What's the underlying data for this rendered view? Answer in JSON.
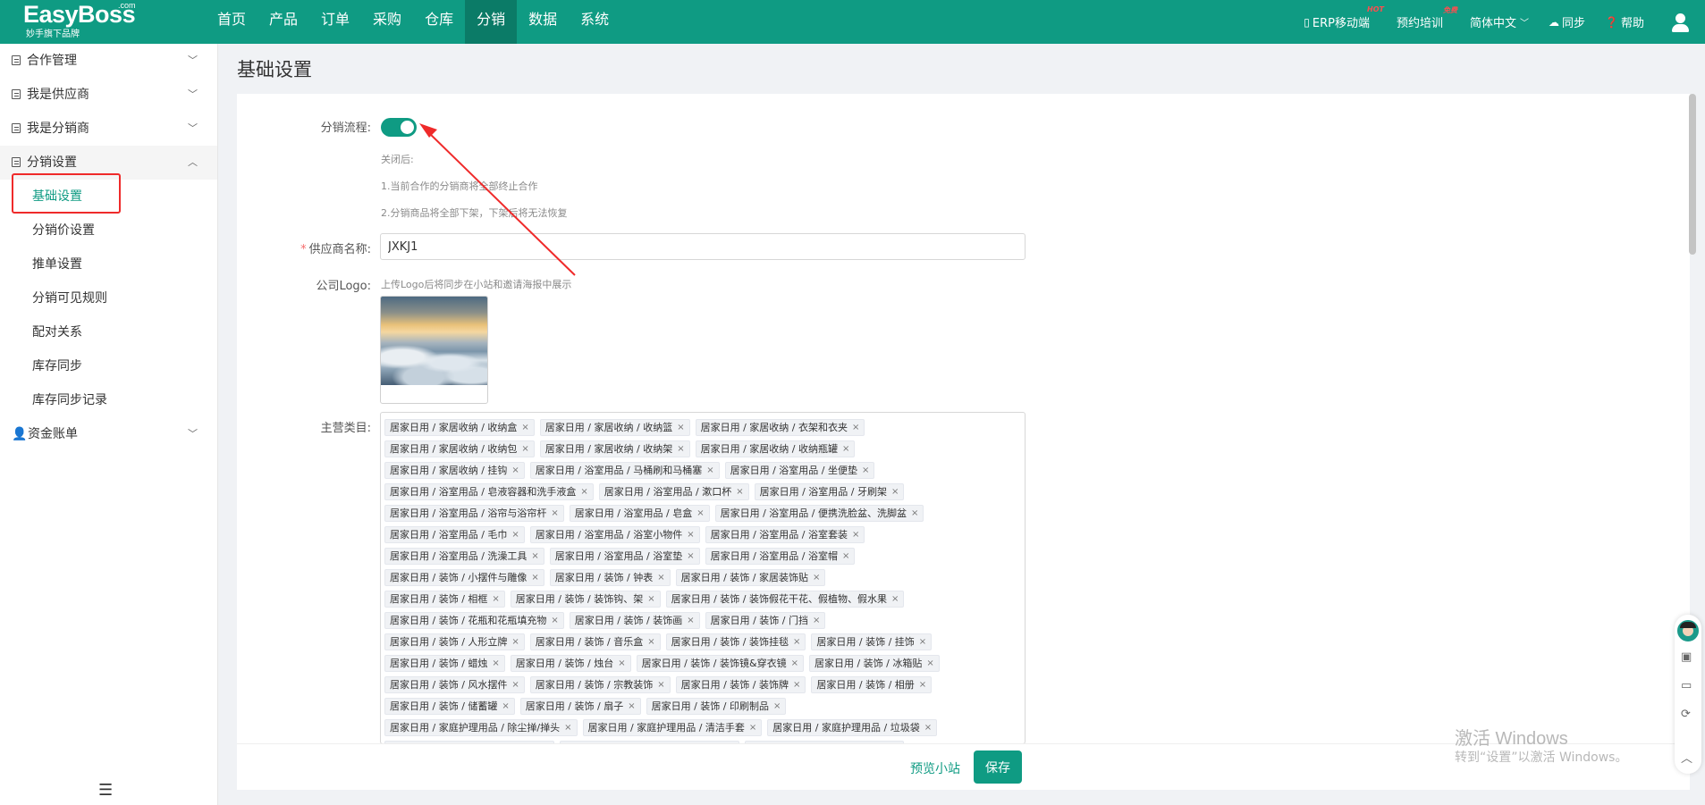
{
  "brand": {
    "name": "EasyBoss",
    "com": ".com",
    "slogan": "妙手旗下品牌"
  },
  "nav": [
    {
      "label": "首页"
    },
    {
      "label": "产品"
    },
    {
      "label": "订单"
    },
    {
      "label": "采购"
    },
    {
      "label": "仓库"
    },
    {
      "label": "分销"
    },
    {
      "label": "数据"
    },
    {
      "label": "系统"
    }
  ],
  "top_right": {
    "erp": "ERP移动端",
    "erp_badge": "HOT",
    "training": "预约培训",
    "training_badge": "免费",
    "language": "简体中文",
    "sync": "同步",
    "help": "帮助"
  },
  "sidebar": {
    "groups": [
      {
        "label": "合作管理"
      },
      {
        "label": "我是供应商"
      },
      {
        "label": "我是分销商"
      },
      {
        "label": "分销设置"
      },
      {
        "label": "资金账单"
      }
    ],
    "sub_items": [
      {
        "label": "基础设置"
      },
      {
        "label": "分销价设置"
      },
      {
        "label": "推单设置"
      },
      {
        "label": "分销可见规则"
      },
      {
        "label": "配对关系"
      },
      {
        "label": "库存同步"
      },
      {
        "label": "库存同步记录"
      }
    ]
  },
  "page": {
    "title": "基础设置"
  },
  "form": {
    "flow_label": "分销流程:",
    "flow_enabled": true,
    "hints": [
      "关闭后:",
      "1.当前合作的分销商将全部终止合作",
      "2.分销商品将全部下架，下架后将无法恢复"
    ],
    "supplier_label": "供应商名称:",
    "supplier_value": "JXKJ1",
    "logo_label": "公司Logo:",
    "logo_hint": "上传Logo后将同步在小站和邀请海报中展示",
    "category_label": "主营类目:",
    "tag_rows": [
      [
        "居家日用 / 家居收纳 / 收纳盒",
        "居家日用 / 家居收纳 / 收纳篮",
        "居家日用 / 家居收纳 / 衣架和衣夹"
      ],
      [
        "居家日用 / 家居收纳 / 收纳包",
        "居家日用 / 家居收纳 / 收纳架",
        "居家日用 / 家居收纳 / 收纳瓶罐"
      ],
      [
        "居家日用 / 家居收纳 / 挂钩",
        "居家日用 / 浴室用品 / 马桶刷和马桶塞",
        "居家日用 / 浴室用品 / 坐便垫"
      ],
      [
        "居家日用 / 浴室用品 / 皂液容器和洗手液盒",
        "居家日用 / 浴室用品 / 漱口杯",
        "居家日用 / 浴室用品 / 牙刷架"
      ],
      [
        "居家日用 / 浴室用品 / 浴帘与浴帘杆",
        "居家日用 / 浴室用品 / 皂盒",
        "居家日用 / 浴室用品 / 便携洗脸盆、洗脚盆"
      ],
      [
        "居家日用 / 浴室用品 / 毛巾",
        "居家日用 / 浴室用品 / 浴室小物件",
        "居家日用 / 浴室用品 / 浴室套装"
      ],
      [
        "居家日用 / 浴室用品 / 洗澡工具",
        "居家日用 / 浴室用品 / 浴室垫",
        "居家日用 / 浴室用品 / 浴室帽"
      ],
      [
        "居家日用 / 装饰 / 小摆件与雕像",
        "居家日用 / 装饰 / 钟表",
        "居家日用 / 装饰 / 家居装饰贴"
      ],
      [
        "居家日用 / 装饰 / 相框",
        "居家日用 / 装饰 / 装饰钩、架",
        "居家日用 / 装饰 / 装饰假花干花、假植物、假水果"
      ],
      [
        "居家日用 / 装饰 / 花瓶和花瓶填充物",
        "居家日用 / 装饰 / 装饰画",
        "居家日用 / 装饰 / 门挡"
      ],
      [
        "居家日用 / 装饰 / 人形立牌",
        "居家日用 / 装饰 / 音乐盒",
        "居家日用 / 装饰 / 装饰挂毯",
        "居家日用 / 装饰 / 挂饰"
      ],
      [
        "居家日用 / 装饰 / 蜡烛",
        "居家日用 / 装饰 / 烛台",
        "居家日用 / 装饰 / 装饰镜&穿衣镜",
        "居家日用 / 装饰 / 冰箱贴"
      ],
      [
        "居家日用 / 装饰 / 风水摆件",
        "居家日用 / 装饰 / 宗教装饰",
        "居家日用 / 装饰 / 装饰牌",
        "居家日用 / 装饰 / 相册"
      ],
      [
        "居家日用 / 装饰 / 储蓄罐",
        "居家日用 / 装饰 / 扇子",
        "居家日用 / 装饰 / 印刷制品"
      ],
      [
        "居家日用 / 家庭护理用品 / 除尘掸/掸头",
        "居家日用 / 家庭护理用品 / 清洁手套",
        "居家日用 / 家庭护理用品 / 垃圾袋"
      ],
      [
        "居家日用 / 家庭护理用品 / 垃圾桶",
        "居家日用 / 家庭护理用品 / 清洁抹布",
        "居家日用 / 家庭护理用品 / 扫把"
      ]
    ]
  },
  "actions": {
    "preview": "预览小站",
    "save": "保存"
  },
  "watermark": {
    "line1": "激活 Windows",
    "line2": "转到“设置”以激活 Windows。"
  },
  "colors": {
    "primary": "#0f9b83",
    "nav_active": "#0b7b67",
    "annotation": "#ef2a2a"
  }
}
